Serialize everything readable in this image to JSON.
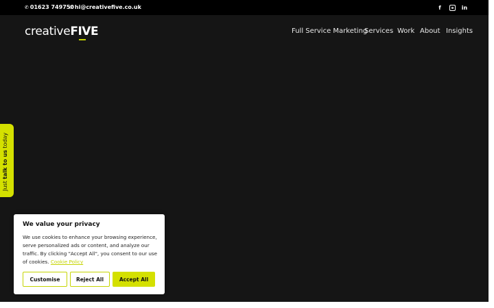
{
  "topbar": {
    "phone": "01623 749750",
    "email": "hi@creativefive.co.uk",
    "social": [
      "facebook-icon",
      "instagram-icon",
      "linkedin-icon"
    ]
  },
  "logo": {
    "part1": "creative",
    "part2": "FIVE"
  },
  "nav": {
    "items": [
      "Full Service Marketing",
      "Services",
      "Work",
      "About",
      "Insights"
    ]
  },
  "side_tab": {
    "prefix": "Just ",
    "bold": "talk to us",
    "suffix": " today"
  },
  "cookie": {
    "title": "We value your privacy",
    "body": "We use cookies to enhance your browsing experience, serve personalized ads or content, and analyze our traffic. By clicking \"Accept All\", you consent to our use of cookies.",
    "policy_link": "Cookie Policy",
    "customise": "Customise",
    "reject": "Reject All",
    "accept": "Accept All"
  },
  "colors": {
    "accent": "#d4e000",
    "background": "#151515",
    "topbar": "#000000"
  }
}
